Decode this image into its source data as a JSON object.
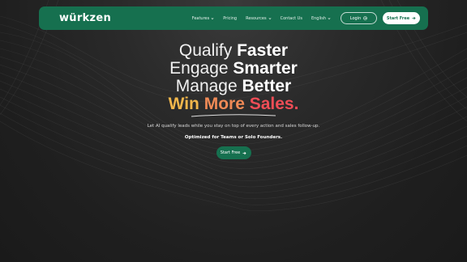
{
  "brand": {
    "name": "würkzen"
  },
  "nav": {
    "items": [
      {
        "label": "Features",
        "has_dropdown": true
      },
      {
        "label": "Pricing",
        "has_dropdown": false
      },
      {
        "label": "Resources",
        "has_dropdown": true
      },
      {
        "label": "Contact Us",
        "has_dropdown": false
      },
      {
        "label": "English",
        "has_dropdown": true
      }
    ],
    "login_label": "Login",
    "start_label": "Start Free"
  },
  "hero": {
    "line1_light": "Qualify ",
    "line1_bold": "Faster",
    "line2_light": "Engage ",
    "line2_bold": "Smarter",
    "line3_light": "Manage ",
    "line3_bold": "Better",
    "win_1": "Win ",
    "win_2": "More ",
    "win_3": "Sales.",
    "subtitle": "Let AI qualify leads while you stay on top of every action and sales follow-up.",
    "optimized": "Optimized for Teams or Solo Founders.",
    "cta_label": "Start Free"
  },
  "colors": {
    "brand_green": "#16704f",
    "win_yellow": "#f2b74b",
    "win_orange": "#f08a56",
    "win_red": "#ef4d56"
  }
}
